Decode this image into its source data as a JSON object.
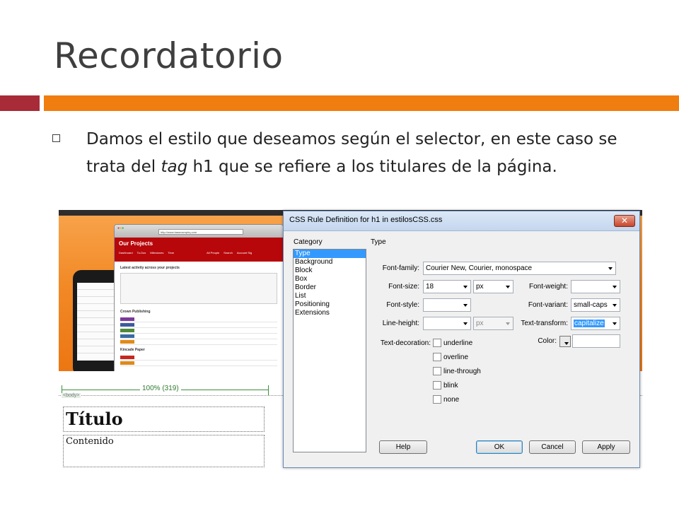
{
  "slide": {
    "title": "Recordatorio",
    "bullet_part1": "Damos el estilo que deseamos según el selector, en este caso se trata del ",
    "bullet_em": "tag",
    "bullet_part2": " h1  que se refiere a los titulares de la página."
  },
  "colors": {
    "bar_red": "#a82b38",
    "bar_orange": "#ef7d0f",
    "selection": "#3399ff"
  },
  "browser": {
    "url": "http://www.basecamphq.com",
    "heading": "Our Projects",
    "tabs": [
      "Dashboard",
      "To-Dos",
      "Milestones",
      "Time",
      "All People",
      "Search",
      "Account Sig"
    ],
    "section1": "Latest activity across your projects",
    "section2": "Crown Publishing",
    "section3": "Kincade Paper"
  },
  "design_view": {
    "ruler_label": "100% (319)",
    "body_tag": "<body>",
    "h1_text": "Título",
    "p_text": "Contenido"
  },
  "dialog": {
    "title": "CSS Rule Definition for h1 in estilosCSS.css",
    "close_icon": "close-icon",
    "category_label": "Category",
    "type_label": "Type",
    "categories": [
      "Type",
      "Background",
      "Block",
      "Box",
      "Border",
      "List",
      "Positioning",
      "Extensions"
    ],
    "selected_category": "Type",
    "font_family_label": "Font-family:",
    "font_family_value": "Courier New, Courier, monospace",
    "font_size_label": "Font-size:",
    "font_size_value": "18",
    "font_size_unit": "px",
    "font_weight_label": "Font-weight:",
    "font_weight_value": "",
    "font_style_label": "Font-style:",
    "font_style_value": "",
    "font_variant_label": "Font-variant:",
    "font_variant_value": "small-caps",
    "line_height_label": "Line-height:",
    "line_height_value": "",
    "line_height_unit": "px",
    "text_transform_label": "Text-transform:",
    "text_transform_value": "capitalize",
    "color_label": "Color:",
    "color_value": "",
    "text_decoration_label": "Text-decoration:",
    "decorations": [
      "underline",
      "overline",
      "line-through",
      "blink",
      "none"
    ],
    "help_button": "Help",
    "ok_button": "OK",
    "cancel_button": "Cancel",
    "apply_button": "Apply"
  }
}
